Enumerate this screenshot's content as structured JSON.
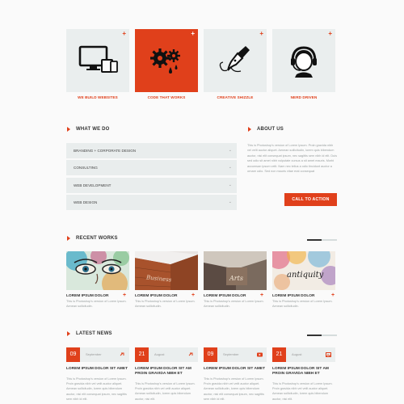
{
  "features": [
    {
      "label": "WE BUILD WEBSITES",
      "icon": "devices-icon"
    },
    {
      "label": "CODE THAT WORKS",
      "icon": "gears-icon"
    },
    {
      "label": "CREATIVE SHIZZLE",
      "icon": "pen-nib-icon"
    },
    {
      "label": "NERD DRIVEN",
      "icon": "headset-user-icon"
    }
  ],
  "plus": "+",
  "what_we_do": {
    "title": "WHAT WE DO",
    "items": [
      "BRANDING + CORPORATE DESIGN",
      "CONSULTING",
      "WEB DEVELOPMENT",
      "WEB DESIGN"
    ]
  },
  "about": {
    "title": "ABOUT US",
    "text": "This is Photoshop's version of Lorem Ipsum. Proin gravida nibh vel velit auctor aliquet. Aenean sollicitudin, lorem quis bibendum auctor, nisi elit consequat ipsum, nec sagittis sem nibh id elit. Duis sed odio sit amet nibh vulputate cursus a sit amet mauris. Morbi accumsan ipsum velit. Nam nec tellus a odio tincidunt auctor a ornare odio. Sed non mauris vitae erat consequat",
    "cta": "CALL TO ACTION"
  },
  "recent_works": {
    "title": "RECENT WORKS",
    "items": [
      {
        "title": "LOREM IPSUM DOLOR",
        "text": "This is Photoshop's version of Lorem Ipsum. Aenean sollicitudin."
      },
      {
        "title": "LOREM IPSUM DOLOR",
        "text": "This is Photoshop's version of Lorem Ipsum. Aenean sollicitudin."
      },
      {
        "title": "LOREM IPSUM DOLOR",
        "text": "This is Photoshop's version of Lorem Ipsum. Aenean sollicitudin."
      },
      {
        "title": "LOREM IPSUM DOLOR",
        "text": "This is Photoshop's version of Lorem Ipsum. Aenean sollicitudin."
      }
    ],
    "image_texts": [
      "Business",
      "Arts",
      "antiquity"
    ]
  },
  "latest_news": {
    "title": "LATEST NEWS",
    "items": [
      {
        "day": "09",
        "month": "September",
        "icon": "link-icon",
        "title": "LOREM IPSUM DOLOR SIT AMET",
        "text": "This is Photoshop's version of Lorem Ipsum. Proin gravida nibh vel velit auctor aliquet. Aenean sollicitudin, lorem quis bibendum auctor, nisi elit consequat ipsum, nec sagittis sem nibh id elit."
      },
      {
        "day": "21",
        "month": "August",
        "icon": "link-icon",
        "title": "LOREM IPSUM DOLOR SIT AM PROIN GRAVIDA NIBH ET",
        "text": "This is Photoshop's version of Lorem Ipsum. Proin gravida nibh vel velit auctor aliquet. Aenean sollicitudin, lorem quis bibendum auctor, nisi elit."
      },
      {
        "day": "09",
        "month": "September",
        "icon": "video-icon",
        "title": "LOREM IPSUM DOLOR SIT AMET",
        "text": "This is Photoshop's version of Lorem Ipsum. Proin gravida nibh vel velit auctor aliquet. Aenean sollicitudin, lorem quis bibendum auctor, nisi elit consequat ipsum, nec sagittis sem nibh id elit."
      },
      {
        "day": "21",
        "month": "August",
        "icon": "image-icon",
        "title": "LOREM IPSUM DOLOR SIT AM PROIN GRAVIDA NIBH ET",
        "text": "This is Photoshop's version of Lorem Ipsum. Proin gravida nibh vel velit auctor aliquet. Aenean sollicitudin, lorem quis bibendum auctor, nisi elit."
      }
    ]
  },
  "colors": {
    "accent": "#e0401b",
    "box": "#eaeeee",
    "background": "#fafafa"
  }
}
